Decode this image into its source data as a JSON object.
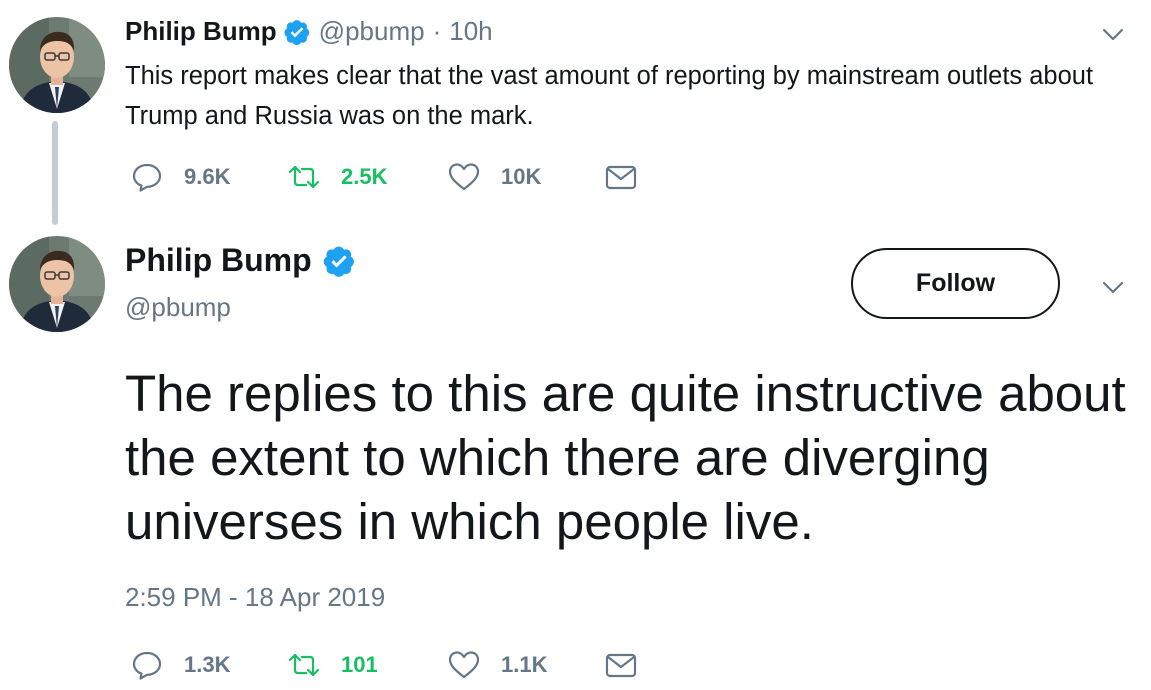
{
  "parent_tweet": {
    "author_name": "Philip Bump",
    "handle": "@pbump",
    "separator": "·",
    "age": "10h",
    "text": "This report makes clear that the vast amount of reporting by mainstream outlets about Trump and Russia was on the mark.",
    "actions": {
      "replies": "9.6K",
      "retweets": "2.5K",
      "likes": "10K"
    }
  },
  "main_tweet": {
    "author_name": "Philip Bump",
    "handle": "@pbump",
    "follow_label": "Follow",
    "text": "The replies to this are quite instructive about the extent to which there are diverging universes in which people live.",
    "timestamp": "2:59 PM - 18 Apr 2019",
    "actions": {
      "replies": "1.3K",
      "retweets": "101",
      "likes": "1.1K"
    }
  },
  "colors": {
    "text": "#14171a",
    "muted": "#657786",
    "retweet_green": "#17bf63",
    "verified_blue": "#1da1f2",
    "thread_line": "#c4cdd5"
  },
  "icons": [
    "verified-badge-icon",
    "chevron-down-icon",
    "reply-icon",
    "retweet-icon",
    "like-icon",
    "direct-message-icon"
  ]
}
